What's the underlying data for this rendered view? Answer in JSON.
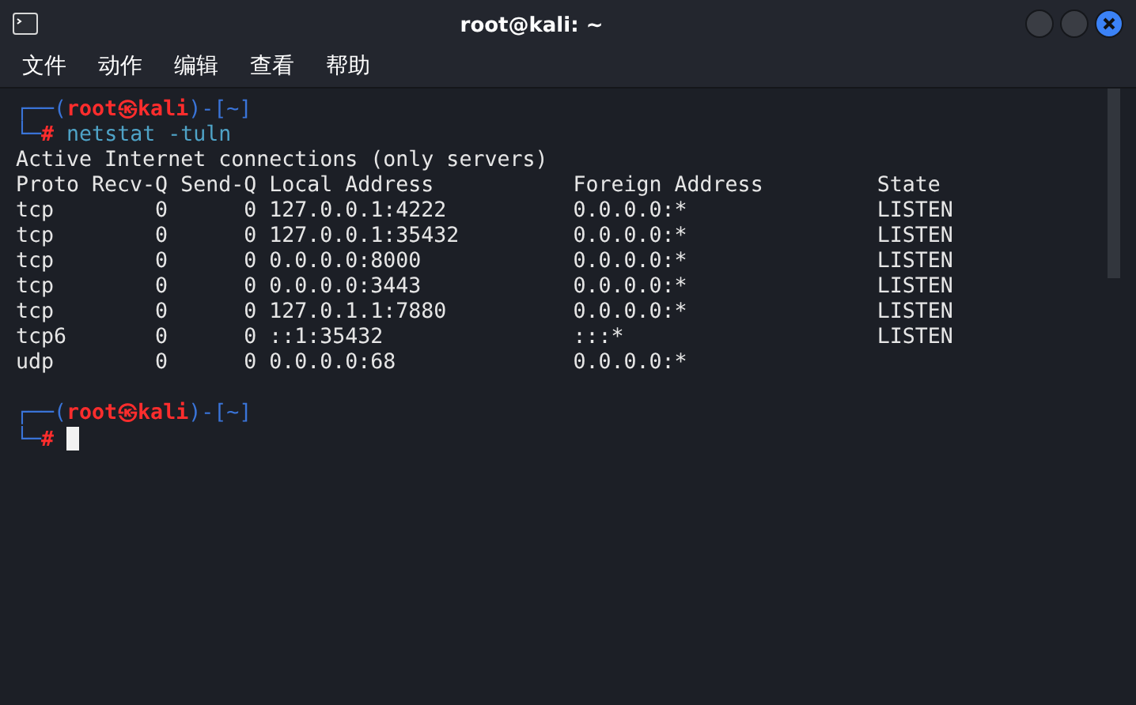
{
  "window": {
    "title": "root@kali: ~"
  },
  "menu": [
    {
      "label": "文件"
    },
    {
      "label": "动作"
    },
    {
      "label": "编辑"
    },
    {
      "label": "查看"
    },
    {
      "label": "帮助"
    }
  ],
  "terminal": {
    "blocks": [
      {
        "kind": "prompt",
        "open": "┌──(",
        "user": "root㉿kali",
        "sep": ")-[",
        "dir": "~",
        "close": "]",
        "corner": "└─",
        "symbol": "#",
        "command": "netstat -tuln",
        "cursor": false
      },
      {
        "kind": "output",
        "lines": [
          "Active Internet connections (only servers)",
          "Proto Recv-Q Send-Q Local Address           Foreign Address         State",
          "tcp        0      0 127.0.0.1:4222          0.0.0.0:*               LISTEN",
          "tcp        0      0 127.0.0.1:35432         0.0.0.0:*               LISTEN",
          "tcp        0      0 0.0.0.0:8000            0.0.0.0:*               LISTEN",
          "tcp        0      0 0.0.0.0:3443            0.0.0.0:*               LISTEN",
          "tcp        0      0 127.0.1.1:7880          0.0.0.0:*               LISTEN",
          "tcp6       0      0 ::1:35432               :::*                    LISTEN",
          "udp        0      0 0.0.0.0:68              0.0.0.0:*"
        ]
      },
      {
        "kind": "prompt",
        "open": "┌──(",
        "user": "root㉿kali",
        "sep": ")-[",
        "dir": "~",
        "close": "]",
        "corner": "└─",
        "symbol": "#",
        "cursor": true
      }
    ]
  }
}
